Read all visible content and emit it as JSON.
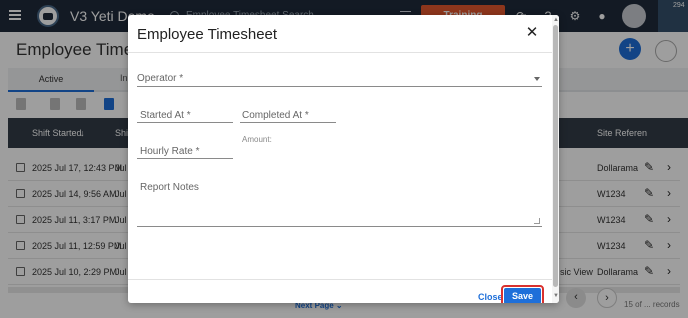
{
  "topbar": {
    "app_title": "V3 Yeti Demo",
    "search_placeholder": "Employee Timesheet Search",
    "training_label": "Training",
    "notification_count": "294"
  },
  "page": {
    "title": "Employee Timesheet",
    "tabs": [
      {
        "label": "Active"
      },
      {
        "label": "In"
      }
    ],
    "table": {
      "headers": {
        "shift_started": "Shift Started",
        "shift2": "Shif",
        "site_reference": "Site Referen"
      },
      "rows": [
        {
          "shift_started": "2025 Jul 17, 12:43 PM",
          "shift2": "Jul 1",
          "extra": "",
          "site": "Dollarama"
        },
        {
          "shift_started": "2025 Jul 14, 9:56 AM",
          "shift2": "Jul 1",
          "extra": "",
          "site": "W1234"
        },
        {
          "shift_started": "2025 Jul 11, 3:17 PM",
          "shift2": "Jul 1",
          "extra": "",
          "site": "W1234"
        },
        {
          "shift_started": "2025 Jul 11, 12:59 PM",
          "shift2": "Jul 1",
          "extra": "",
          "site": "W1234"
        },
        {
          "shift_started": "2025 Jul 10, 2:29 PM",
          "shift2": "Jul 1",
          "extra": "sic View",
          "site": "Dollarama"
        }
      ]
    },
    "pagination": {
      "next_page": "Next Page",
      "records": "15 of ... records"
    }
  },
  "modal": {
    "title": "Employee Timesheet",
    "fields": {
      "operator": "Operator  *",
      "started_at": "Started At  *",
      "completed_at": "Completed At  *",
      "amount": "Amount:",
      "hourly_rate": "Hourly Rate  *",
      "report_notes": "Report Notes"
    },
    "buttons": {
      "close": "Close",
      "save": "Save"
    }
  },
  "colors": {
    "accent": "#1e6fd9",
    "topbar": "#1f2b3a",
    "training": "#e4572e",
    "highlight": "#d9312e"
  }
}
